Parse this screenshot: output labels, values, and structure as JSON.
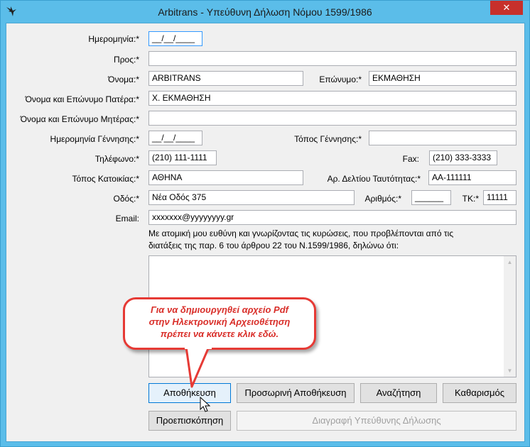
{
  "window": {
    "title": "Arbitrans - Υπεύθυνη Δήλωση Νόμου 1599/1986",
    "close_label": "✕"
  },
  "form": {
    "date": {
      "label": "Ημερομηνία:*",
      "value": "__/__/____"
    },
    "to": {
      "label": "Προς:*",
      "value": ""
    },
    "name": {
      "label": "Όνομα:*",
      "value": "ARBITRANS"
    },
    "surname": {
      "label": "Επώνυμο:*",
      "value": "ΕΚΜΑΘΗΣΗ"
    },
    "father": {
      "label": "Όνομα και Επώνυμο Πατέρα:*",
      "value": "Χ. ΕΚΜΑΘΗΣΗ"
    },
    "mother": {
      "label": "Όνομα και Επώνυμο Μητέρας:*",
      "value": ""
    },
    "birth_date": {
      "label": "Ημερομηνία Γέννησης:*",
      "value": "__/__/____"
    },
    "birth_place": {
      "label": "Τόπος Γέννησης:*",
      "value": ""
    },
    "phone": {
      "label": "Τηλέφωνο:*",
      "value": "(210) 111-1111"
    },
    "fax": {
      "label": "Fax:",
      "value": "(210) 333-3333"
    },
    "residence": {
      "label": "Τόπος Κατοικίας:*",
      "value": "ΑΘΗΝΑ"
    },
    "id_number": {
      "label": "Αρ. Δελτίου Ταυτότητας:*",
      "value": "ΑΑ-111111"
    },
    "street": {
      "label": "Οδός:*",
      "value": "Νέα Οδός 375"
    },
    "street_number": {
      "label": "Αριθμός:*",
      "value": "______"
    },
    "postal_code": {
      "label": "ΤΚ:*",
      "value": "11111"
    },
    "email": {
      "label": "Email:",
      "value": "xxxxxxx@yyyyyyyy.gr"
    },
    "declaration_line1": "Με ατομική μου ευθύνη και γνωρίζοντας τις κυρώσεις, που προβλέπονται από τις",
    "declaration_line2": "διατάξεις της παρ. 6 του άρθρου 22 του Ν.1599/1986, δηλώνω ότι:",
    "declaration_text": ""
  },
  "buttons": {
    "save": "Αποθήκευση",
    "temp_save": "Προσωρινή Αποθήκευση",
    "search": "Αναζήτηση",
    "clear": "Καθαρισμός",
    "preview": "Προεπισκόπηση",
    "delete": "Διαγραφή Υπεύθυνης Δήλωσης"
  },
  "callout": {
    "line1": "Για να δημιουργηθεί αρχείο Pdf",
    "line2": "στην Ηλεκτρονική Αρχειοθέτηση",
    "line3": "πρέπει να κάνετε κλικ εδώ.",
    "color": "#e63a35"
  },
  "icons": {
    "app": "bird-logo-icon",
    "close": "close-icon",
    "cursor": "mouse-cursor-icon"
  }
}
